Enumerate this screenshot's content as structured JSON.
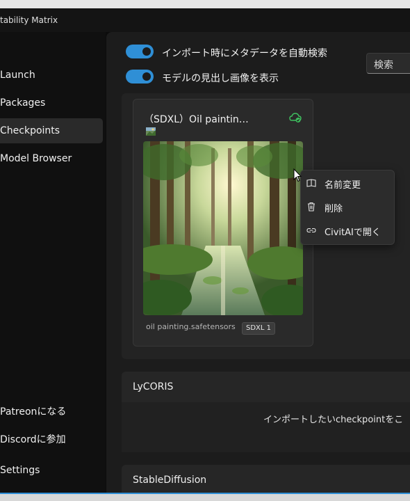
{
  "app": {
    "title": "tability Matrix"
  },
  "sidebar": {
    "items": [
      {
        "label": "Launch"
      },
      {
        "label": "Packages"
      },
      {
        "label": "Checkpoints"
      },
      {
        "label": "Model Browser"
      }
    ],
    "footer_items": [
      {
        "label": "Patreonになる"
      },
      {
        "label": "Discordに参加"
      },
      {
        "label": "Settings"
      }
    ]
  },
  "toolbar": {
    "toggles": [
      {
        "label": "インポート時にメタデータを自動検索",
        "on": true
      },
      {
        "label": "モデルの見出し画像を表示",
        "on": true
      }
    ],
    "search_label": "検索"
  },
  "card": {
    "title": "（SDXL）Oil paintin…",
    "filename": "oil painting.safetensors",
    "badge": "SDXL 1"
  },
  "context_menu": {
    "items": [
      {
        "label": "名前変更",
        "icon": "book-open-icon"
      },
      {
        "label": "削除",
        "icon": "trash-icon"
      },
      {
        "label": "CivitAIで開く",
        "icon": "link-icon"
      }
    ]
  },
  "sections": [
    {
      "title": "LyCORIS",
      "drop_text": "インポートしたいcheckpointをこ"
    },
    {
      "title": "StableDiffusion"
    }
  ],
  "colors": {
    "accent": "#2f8fd6",
    "cloud_check": "#3fbf5f"
  }
}
